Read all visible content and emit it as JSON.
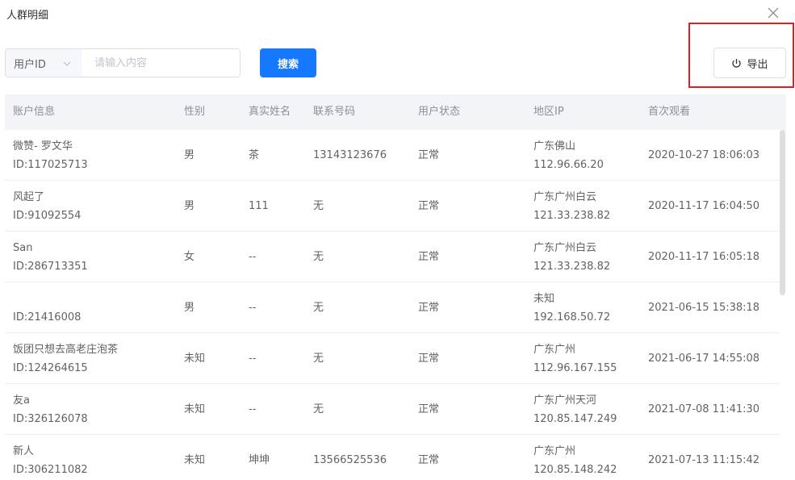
{
  "dialog": {
    "title": "人群明细"
  },
  "filter": {
    "field": "用户ID",
    "placeholder": "请输入内容"
  },
  "buttons": {
    "search": "搜索",
    "export": "导出"
  },
  "table": {
    "columns": [
      "账户信息",
      "性别",
      "真实姓名",
      "联系号码",
      "用户状态",
      "地区IP",
      "首次观看"
    ],
    "rows": [
      {
        "name": "微赞- 罗文华",
        "id": "ID:117025713",
        "gender": "男",
        "real_name": "茶",
        "phone": "13143123676",
        "status": "正常",
        "region": "广东佛山",
        "ip": "112.96.66.20",
        "first_view": "2020-10-27 18:06:03"
      },
      {
        "name": "风起了",
        "id": "ID:91092554",
        "gender": "男",
        "real_name": "111",
        "phone": "无",
        "status": "正常",
        "region": "广东广州白云",
        "ip": "121.33.238.82",
        "first_view": "2020-11-17 16:04:50"
      },
      {
        "name": "San",
        "id": "ID:286713351",
        "gender": "女",
        "real_name": "--",
        "phone": "无",
        "status": "正常",
        "region": "广东广州白云",
        "ip": "121.33.238.82",
        "first_view": "2020-11-17 16:05:18"
      },
      {
        "name": "",
        "id": "ID:21416008",
        "gender": "男",
        "real_name": "--",
        "phone": "无",
        "status": "正常",
        "region": "未知",
        "ip": "192.168.50.72",
        "first_view": "2021-06-15 15:38:18"
      },
      {
        "name": "饭团只想去高老庄泡茶",
        "id": "ID:124264615",
        "gender": "未知",
        "real_name": "--",
        "phone": "无",
        "status": "正常",
        "region": "广东广州",
        "ip": "112.96.167.155",
        "first_view": "2021-06-17 14:55:08"
      },
      {
        "name": "友a",
        "id": "ID:326126078",
        "gender": "未知",
        "real_name": "--",
        "phone": "无",
        "status": "正常",
        "region": "广东广州天河",
        "ip": "120.85.147.249",
        "first_view": "2021-07-08 11:41:30"
      },
      {
        "name": "新人",
        "id": "ID:306211082",
        "gender": "未知",
        "real_name": "坤坤",
        "phone": "13566525536",
        "status": "正常",
        "region": "广东广州",
        "ip": "120.85.148.242",
        "first_view": "2021-07-13 11:15:42"
      }
    ]
  },
  "icons": {
    "close": "close-icon",
    "dropdown": "chevron-down-icon",
    "export": "power-export-icon"
  },
  "colors": {
    "primary": "#1677ff",
    "highlight": "#e02020",
    "header_bg": "#f2f4f7"
  }
}
